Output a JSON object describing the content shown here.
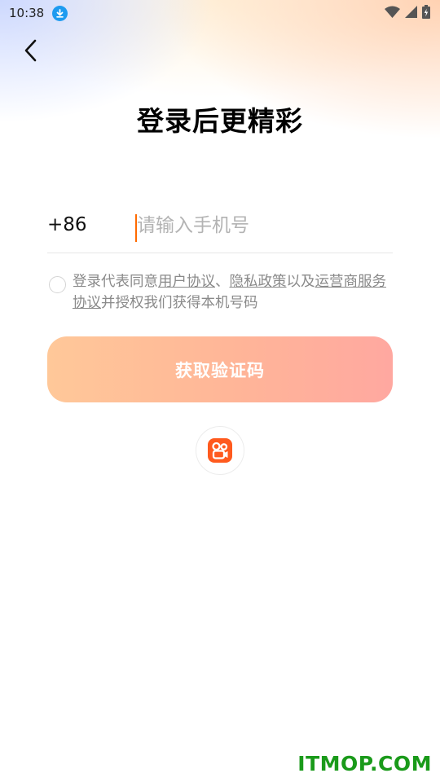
{
  "status_bar": {
    "time": "10:38",
    "icons": [
      "download-icon",
      "wifi-icon",
      "signal-icon",
      "battery-charging-icon"
    ]
  },
  "nav": {
    "back_icon": "chevron-left-icon"
  },
  "title": "登录后更精彩",
  "phone": {
    "country_code": "+86",
    "placeholder": "请输入手机号",
    "value": ""
  },
  "agreement": {
    "checked": false,
    "prefix": "登录代表同意",
    "link1": "用户协议",
    "sep1": "、",
    "link2": "隐私政策",
    "sep2": "以及",
    "link3": "运营商服务协议",
    "suffix": "并授权我们获得本机号码"
  },
  "otp_button": {
    "label": "获取验证码",
    "colors": [
      "#ffc899",
      "#ffa8a0"
    ]
  },
  "alt_login": {
    "icon": "kuaishou-logo-icon",
    "color": "#ff5a1e"
  },
  "watermark": "ITMOP.COM",
  "colors": {
    "accent": "#ff6a00",
    "brand": "#ff5a1e"
  }
}
